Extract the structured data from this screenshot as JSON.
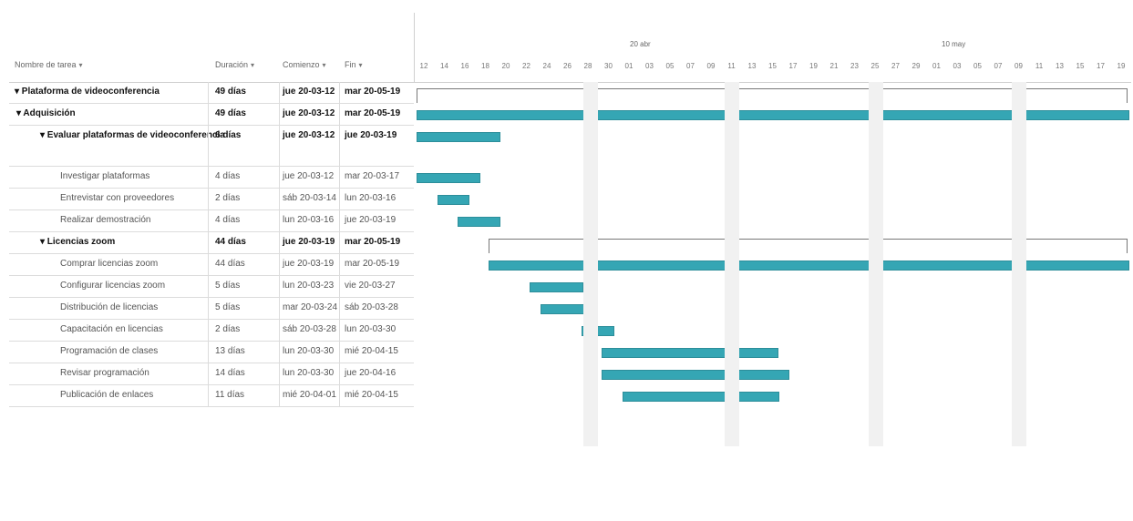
{
  "table": {
    "headers": {
      "name": "Nombre de tarea",
      "duration": "Duración",
      "start": "Comienzo",
      "end": "Fin"
    },
    "rows": [
      {
        "level": 0,
        "type": "summary",
        "name": "▾ Plataforma de videoconferencia",
        "duration": "49 días",
        "start": "jue 20-03-12",
        "end": "mar 20-05-19"
      },
      {
        "level": 1,
        "type": "summary",
        "name": "▾ Adquisición",
        "duration": "49 días",
        "start": "jue 20-03-12",
        "end": "mar 20-05-19"
      },
      {
        "level": 2,
        "type": "summary",
        "name": "▾ Evaluar plataformas de videoconferencia",
        "duration": "6 días",
        "start": "jue 20-03-12",
        "end": "jue 20-03-19"
      },
      {
        "level": 3,
        "type": "task",
        "name": "Investigar plataformas",
        "duration": "4 días",
        "start": "jue 20-03-12",
        "end": "mar 20-03-17"
      },
      {
        "level": 3,
        "type": "task",
        "name": "Entrevistar con proveedores",
        "duration": "2 días",
        "start": "sáb 20-03-14",
        "end": "lun 20-03-16"
      },
      {
        "level": 3,
        "type": "task",
        "name": "Realizar demostración",
        "duration": "4 días",
        "start": "lun 20-03-16",
        "end": "jue 20-03-19"
      },
      {
        "level": 2,
        "type": "summary",
        "name": "▾ Licencias zoom",
        "duration": "44 días",
        "start": "jue 20-03-19",
        "end": "mar 20-05-19"
      },
      {
        "level": 3,
        "type": "task",
        "name": "Comprar licencias zoom",
        "duration": "44 días",
        "start": "jue 20-03-19",
        "end": "mar 20-05-19"
      },
      {
        "level": 3,
        "type": "task",
        "name": "Configurar licencias zoom",
        "duration": "5 días",
        "start": "lun 20-03-23",
        "end": "vie 20-03-27"
      },
      {
        "level": 3,
        "type": "task",
        "name": "Distribución de licencias",
        "duration": "5 días",
        "start": "mar 20-03-24",
        "end": "sáb 20-03-28"
      },
      {
        "level": 3,
        "type": "task",
        "name": "Capacitación en licencias",
        "duration": "2 días",
        "start": "sáb 20-03-28",
        "end": "lun 20-03-30"
      },
      {
        "level": 3,
        "type": "task",
        "name": "Programación de clases",
        "duration": "13 días",
        "start": "lun 20-03-30",
        "end": "mié 20-04-15"
      },
      {
        "level": 3,
        "type": "task",
        "name": "Revisar programación",
        "duration": "14 días",
        "start": "lun 20-03-30",
        "end": "jue 20-04-16"
      },
      {
        "level": 3,
        "type": "task",
        "name": "Publicación de enlaces",
        "duration": "11 días",
        "start": "mié 20-04-01",
        "end": "mié 20-04-15"
      }
    ]
  },
  "timeline": {
    "months": [
      "20 abr",
      "10 may"
    ],
    "day_labels": [
      "12",
      "14",
      "16",
      "18",
      "20",
      "22",
      "24",
      "26",
      "28",
      "30",
      "01",
      "03",
      "05",
      "07",
      "09",
      "11",
      "13",
      "15",
      "17",
      "19",
      "21",
      "23",
      "25",
      "27",
      "29",
      "01",
      "03",
      "05",
      "07",
      "09",
      "11",
      "13",
      "15",
      "17",
      "19"
    ]
  },
  "colors": {
    "bar": "#35a6b4",
    "bar_border": "#2d8e9a",
    "bracket": "#777777"
  }
}
